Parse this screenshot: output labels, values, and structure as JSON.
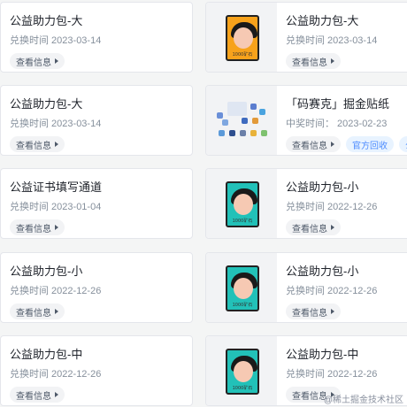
{
  "cards": [
    {
      "title": "公益助力包-大",
      "date": "兑换时间 2023-03-14",
      "button": "查看信息"
    },
    {
      "title": "公益助力包-大",
      "date": "兑换时间 2023-03-14",
      "button": "查看信息",
      "prize_label": "1000矿石"
    },
    {
      "title": "公益助力包-大",
      "date": "兑换时间 2023-03-14",
      "button": "查看信息"
    },
    {
      "title": "「码赛克」掘金贴纸",
      "date": "中奖时间： 2023-02-23",
      "button": "查看信息",
      "button2": "官方回收",
      "button3": "公"
    },
    {
      "title": "公益证书填写通道",
      "date": "兑换时间 2023-01-04",
      "button": "查看信息"
    },
    {
      "title": "公益助力包-小",
      "date": "兑换时间 2022-12-26",
      "button": "查看信息",
      "prize_label": "1000矿石"
    },
    {
      "title": "公益助力包-小",
      "date": "兑换时间 2022-12-26",
      "button": "查看信息"
    },
    {
      "title": "公益助力包-小",
      "date": "兑换时间 2022-12-26",
      "button": "查看信息",
      "prize_label": "1000矿石"
    },
    {
      "title": "公益助力包-中",
      "date": "兑换时间 2022-12-26",
      "button": "查看信息"
    },
    {
      "title": "公益助力包-中",
      "date": "兑换时间 2022-12-26",
      "button": "查看信息",
      "prize_label": "1000矿石"
    }
  ],
  "watermark": "@稀土掘金技术社区",
  "colors": {
    "accent_blue": "#4e8cff",
    "prize_orange": "#f7a21b",
    "prize_teal": "#22c1b8"
  }
}
